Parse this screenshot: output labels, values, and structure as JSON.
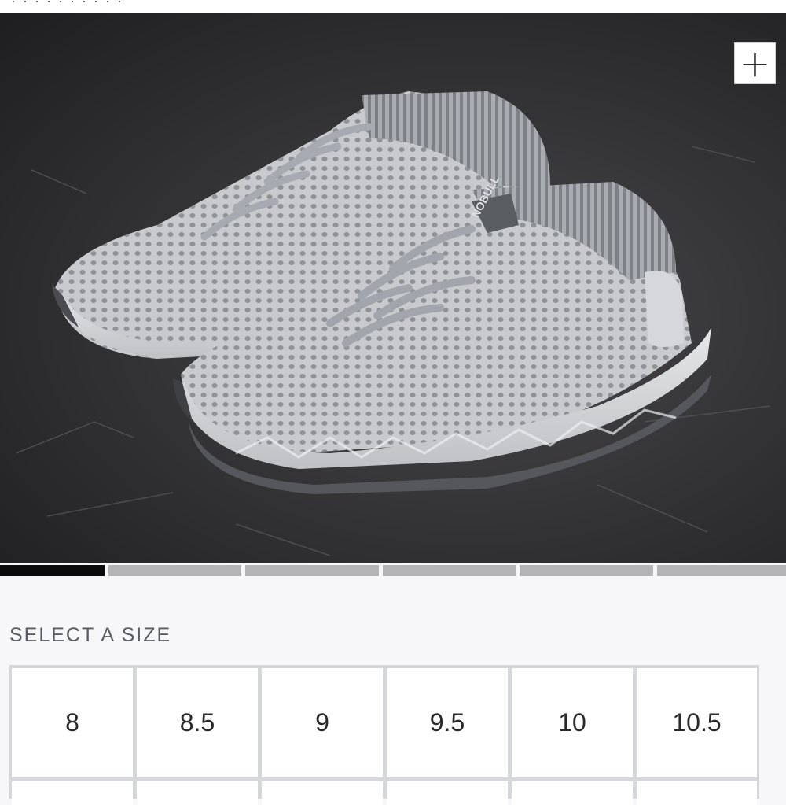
{
  "gallery": {
    "image_alt": "Grey knit running shoes on a concrete floor",
    "brand_mark": "NOBULL",
    "zoom_icon": "plus-icon",
    "slide_count": 6,
    "active_slide": 1
  },
  "size_selector": {
    "title": "SELECT A SIZE",
    "sizes": [
      "8",
      "8.5",
      "9",
      "9.5",
      "10",
      "10.5"
    ]
  },
  "colors": {
    "progress_active": "#0a0a0a",
    "progress_inactive": "#b4b4b6",
    "title_text": "#595d63"
  }
}
